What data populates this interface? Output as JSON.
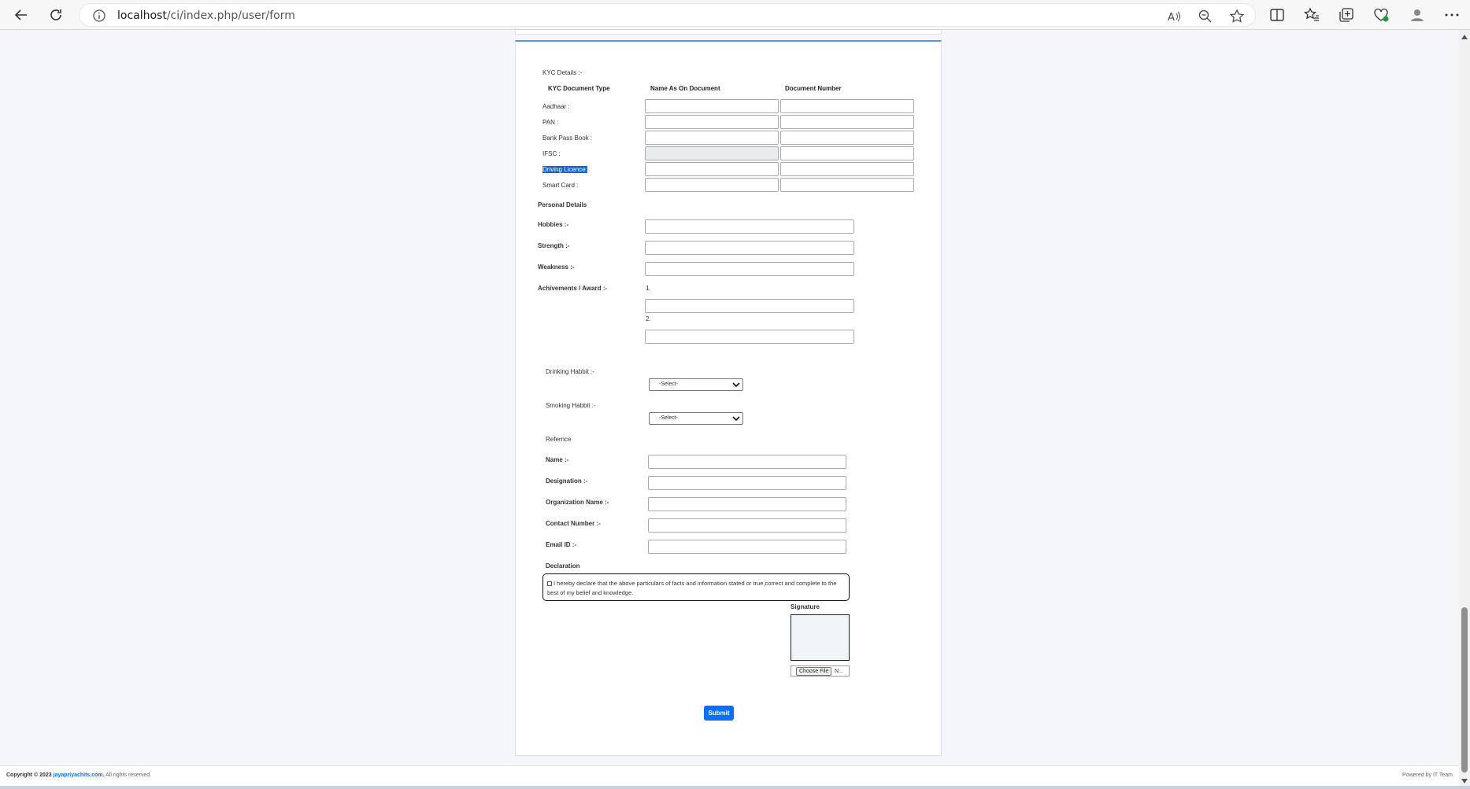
{
  "browser": {
    "url_host": "localhost",
    "url_path": "/ci/index.php/user/form"
  },
  "kyc": {
    "section_label": "KYC Details :-",
    "col_type": "KYC Document Type",
    "col_name": "Name As On Document",
    "col_number": "Document Number",
    "rows": [
      {
        "label": "Aadhaar :"
      },
      {
        "label": "PAN :"
      },
      {
        "label": "Bank Pass Book :"
      },
      {
        "label": "IFSC :"
      },
      {
        "label": "Driving Licence:"
      },
      {
        "label": "Smart Card :"
      }
    ]
  },
  "personal": {
    "heading": "Personal Details",
    "hobbies": "Hobbies :-",
    "strength": "Strength :-",
    "weakness": "Weakness :-",
    "achievements": "Achivements / Award :-",
    "num1": "1.",
    "num2": "2."
  },
  "habits": {
    "drinking_label": "Drinking Habbit :-",
    "drinking_value": "-Select-",
    "smoking_label": "Smoking Habbit :-",
    "smoking_value": "-Select-"
  },
  "reference": {
    "heading": "Refernce",
    "name": "Name :-",
    "designation": "Designation :-",
    "organization": "Organization Name :-",
    "contact": "Contact Number :-",
    "email": "Email ID :-"
  },
  "declaration": {
    "heading": "Declaration",
    "text": "I hereby declare that the above particulars of facts and information stated or true,correct and complete to the best of my belief and knowledge."
  },
  "signature": {
    "label": "Signature",
    "choose_file": "Choose File",
    "no_file": "N..."
  },
  "submit_label": "Submit",
  "footer": {
    "copyright_prefix": "Copyright © 2023",
    "site": "jayapriyachits.com.",
    "rights": "All rights reserved.",
    "powered": "Powered by IT Team"
  }
}
